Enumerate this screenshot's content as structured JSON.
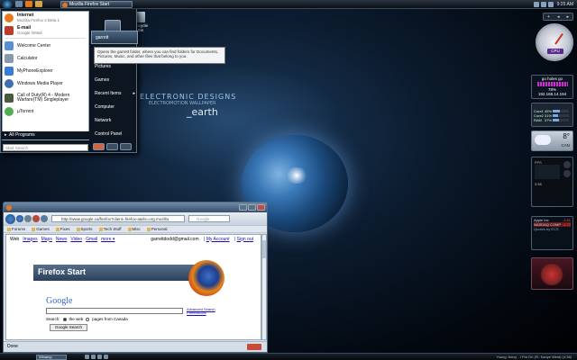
{
  "taskbar_top": {
    "active_task": "Mozilla Firefox Start",
    "clock": "9:25 AM"
  },
  "start_menu": {
    "pinned": [
      {
        "title": "Internet",
        "subtitle": "Mozilla Firefox 2 Beta 1",
        "color": "#e8791a"
      },
      {
        "title": "E-mail",
        "subtitle": "Google GMail",
        "color": "#c0392b"
      }
    ],
    "recent": [
      {
        "title": "Welcome Center",
        "color": "#5b8fd4"
      },
      {
        "title": "Calculator",
        "color": "#8899aa"
      },
      {
        "title": "MyPhoneExplorer",
        "color": "#3a7bd5"
      },
      {
        "title": "Windows Media Player",
        "color": "#3d6fb3"
      },
      {
        "title": "Call of Duty(R) 4 - Modern Warfare(TM) Singleplayer",
        "color": "#4a5a3a"
      },
      {
        "title": "µTorrent",
        "color": "#4caf50"
      }
    ],
    "all_programs": "All Programs",
    "search_placeholder": "Start Search",
    "right_items": [
      "garrett",
      "Pictures",
      "Games",
      "Recent Items",
      "Computer",
      "Network",
      "Control Panel"
    ],
    "tooltip": "Opens the garrett folder, where you can find folders for Documents, Pictures, Music, and other files that belong to you."
  },
  "desktop": {
    "recycle_bin": "Recycle Bin",
    "logo": {
      "line1": "ELECTRONIC DESIGNS",
      "line2": "ELECTROMOTION WALLPAPER",
      "line3": "_earth"
    }
  },
  "browser": {
    "url": "http://www.google.ca/firefox?client=firefox-a&rls=org.mozilla",
    "search_placeholder": "Google",
    "bookmarks": [
      "Forums",
      "Games",
      "Fixes",
      "Sports",
      "Tech Stuff",
      "Misc",
      "Personal"
    ],
    "google_links": [
      "Web",
      "Images",
      "Maps",
      "News",
      "Video",
      "Gmail",
      "more ▾"
    ],
    "account_email": "garrettdodd@gmail.com",
    "my_account": "My Account",
    "sign_out": "Sign out",
    "banner": "Firefox Start",
    "google_logo": "Google",
    "advanced_search": "Advanced Search Preferences",
    "search_label": "Search:",
    "radio_web": "the web",
    "radio_canada": "pages from Canada",
    "google_search_button": "Google Search",
    "status": "Done"
  },
  "sidebar": {
    "controls": [
      "+",
      "◂",
      "▸"
    ],
    "gauge_label": "CPU",
    "net": {
      "title": "go holes go",
      "speed": "78%",
      "ip": "192.168.14.194"
    },
    "cpu": [
      {
        "label": "Core1",
        "value": "45%",
        "fraction": 0.45
      },
      {
        "label": "Core2",
        "value": "31%",
        "fraction": 0.31
      },
      {
        "label": "RAM",
        "value": "37%",
        "fraction": 0.37
      }
    ],
    "weather": {
      "temp": "8°",
      "location": "CAN"
    },
    "media": {
      "title": "FPS",
      "time": "3:58"
    },
    "stocks": [
      {
        "name": "Apple Inc",
        "change": "-1.61"
      },
      {
        "name": "NASDAQ COMP",
        "change": "-9.72"
      },
      {
        "name": "Quotes by ECS",
        "change": ""
      }
    ]
  },
  "taskbar_bottom": {
    "media_button": "Winamp",
    "now_playing": "Young Jeezy - I Put On (Ft. Kanye West) (4:38)"
  }
}
